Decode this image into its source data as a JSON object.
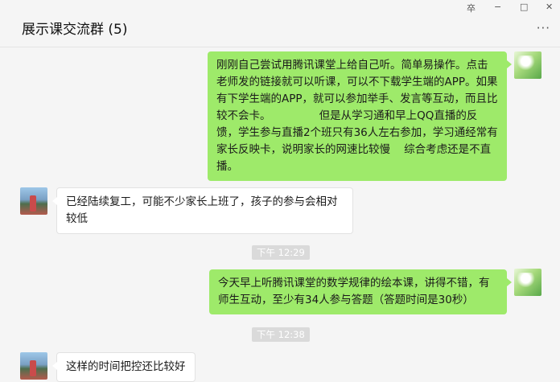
{
  "window": {
    "title": "展示课交流群 (5)",
    "controls": {
      "pin": "卒",
      "minimize": "−",
      "maximize": "□",
      "close": "✕"
    },
    "more": "···"
  },
  "messages": [
    {
      "side": "right",
      "text": "刚刚自己尝试用腾讯课堂上给自己听。简单易操作。点击老师发的链接就可以听课，可以不下载学生端的APP。如果有下学生端的APP，就可以参加举手、发言等互动，而且比较不会卡。              但是从学习通和早上QQ直播的反馈，学生参与直播2个班只有36人左右参加，学习通经常有家长反映卡，说明家长的网速比较慢    综合考虑还是不直播。"
    },
    {
      "side": "left",
      "text": "已经陆续复工，可能不少家长上班了，孩子的参与会相对较低"
    },
    {
      "side": "time",
      "text": "下午 12:29"
    },
    {
      "side": "right",
      "text": "今天早上听腾讯课堂的数学规律的绘本课，讲得不错，有师生互动，至少有34人参与答题（答题时间是30秒）"
    },
    {
      "side": "time",
      "text": "下午 12:38"
    },
    {
      "side": "left",
      "text": "这样的时间把控还比较好"
    }
  ]
}
